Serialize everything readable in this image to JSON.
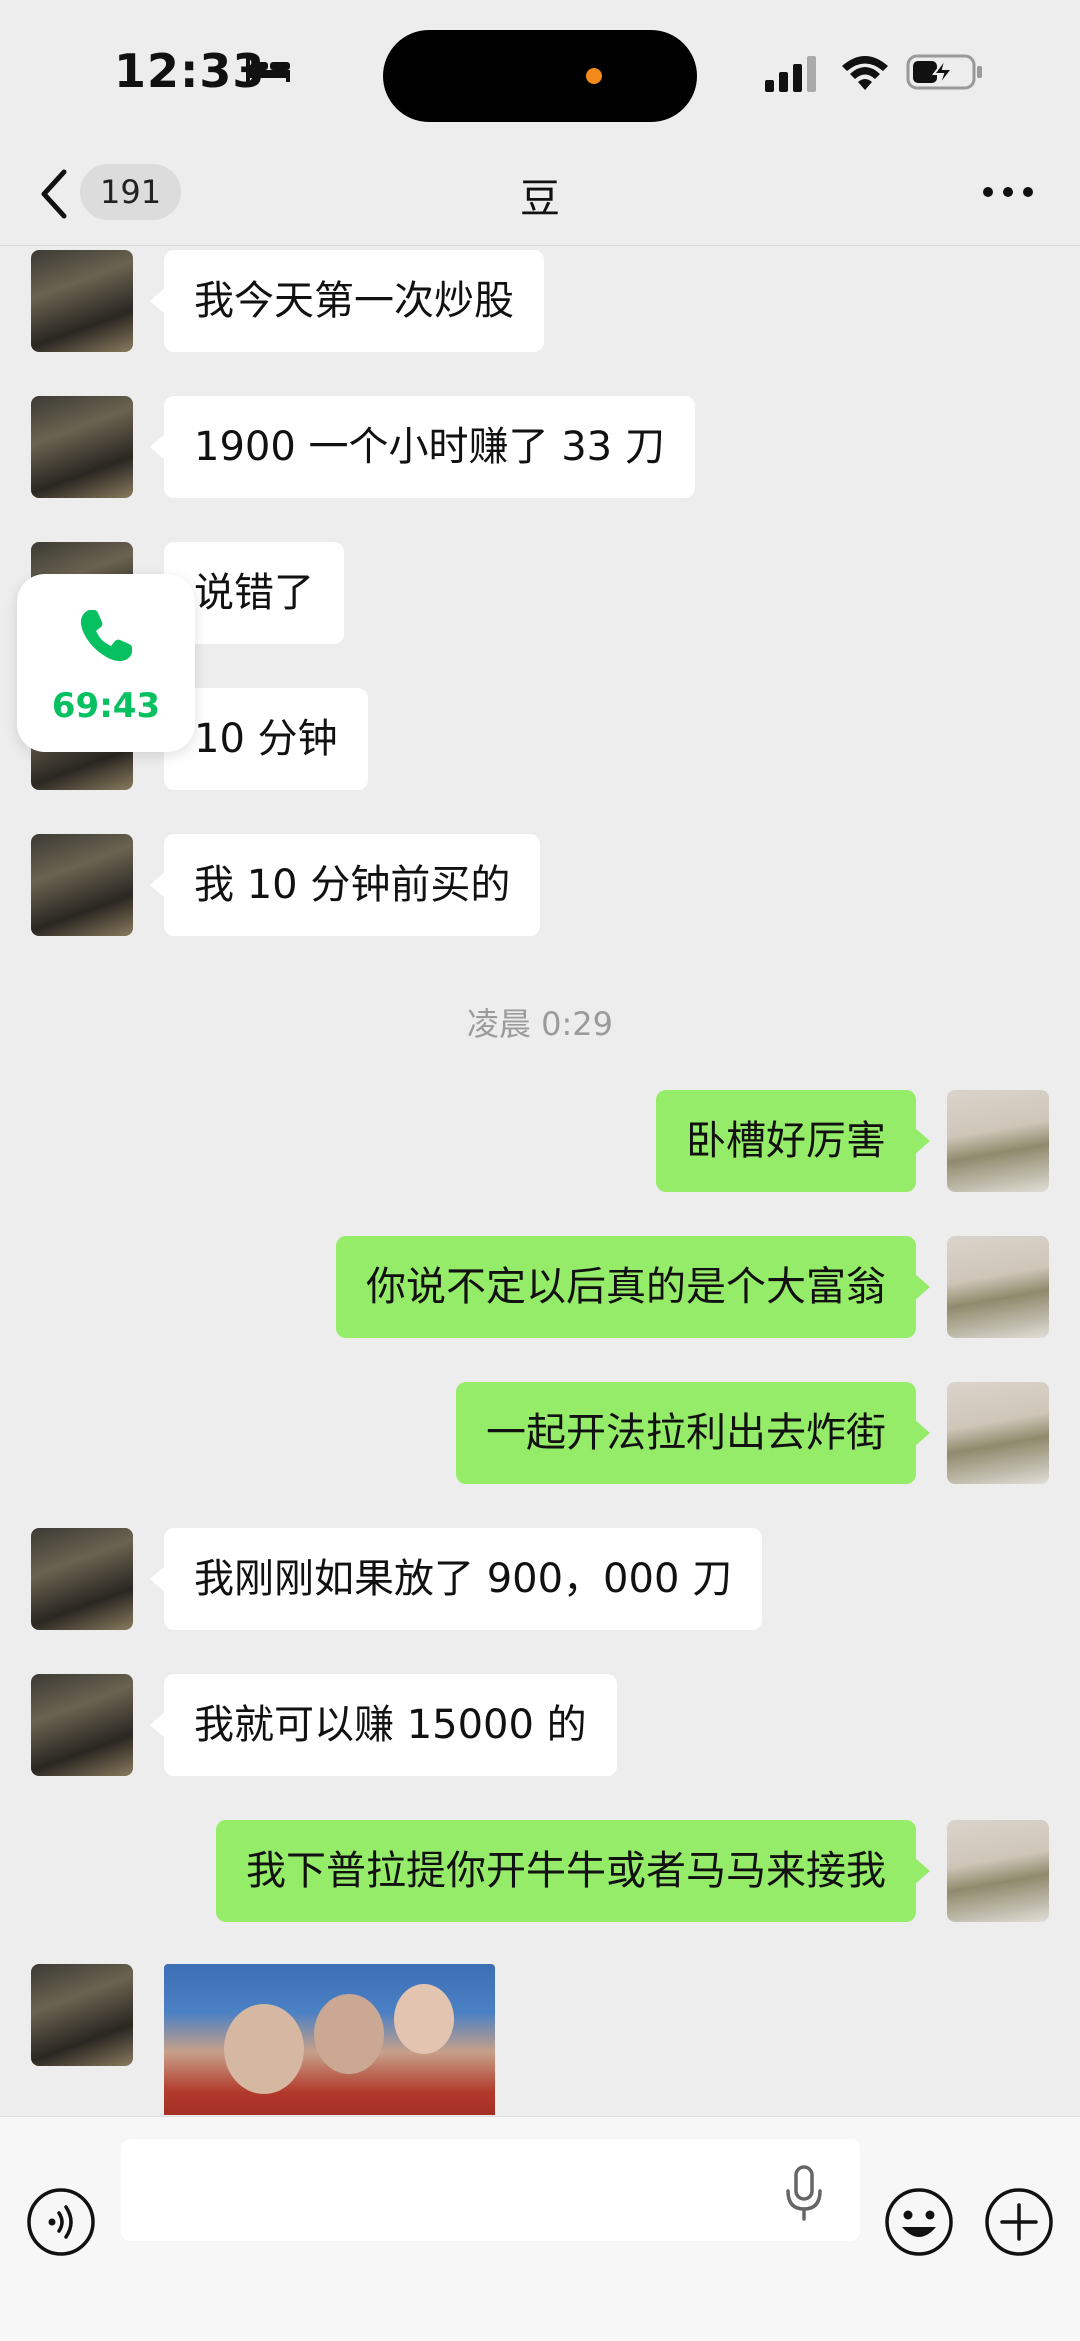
{
  "status_bar": {
    "time": "12:33",
    "icons": [
      "bed-icon",
      "signal-icon",
      "wifi-icon",
      "battery-charging-icon"
    ]
  },
  "nav": {
    "back_icon": "chevron-left-icon",
    "unread_count": "191",
    "title": "豆",
    "more_icon": "ellipsis-icon"
  },
  "messages": [
    {
      "sender": "other",
      "text": "我今天第一次炒股"
    },
    {
      "sender": "other",
      "text": "1900 一个小时赚了 33 刀"
    },
    {
      "sender": "other",
      "text": "说错了"
    },
    {
      "sender": "other",
      "text": "10 分钟"
    },
    {
      "sender": "other",
      "text": "我 10 分钟前买的"
    },
    {
      "sender": "me",
      "text": "卧槽好厉害"
    },
    {
      "sender": "me",
      "text": "你说不定以后真的是个大富翁"
    },
    {
      "sender": "me",
      "text": "一起开法拉利出去炸街"
    },
    {
      "sender": "other",
      "text": "我刚刚如果放了 900，000 刀"
    },
    {
      "sender": "other",
      "text": "我就可以赚 15000 的"
    },
    {
      "sender": "me",
      "text": "我下普拉提你开牛牛或者马马来接我"
    },
    {
      "sender": "other",
      "type": "image"
    }
  ],
  "timestamp": "凌晨 0:29",
  "call_widget": {
    "icon": "phone-icon",
    "duration": "69:43",
    "color": "#07c160"
  },
  "input_bar": {
    "voice_icon": "voice-toggle-icon",
    "mic_icon": "microphone-icon",
    "emoji_icon": "emoji-icon",
    "plus_icon": "plus-icon"
  },
  "colors": {
    "background": "#ededed",
    "outgoing_bubble": "#95ec69",
    "incoming_bubble": "#ffffff",
    "accent": "#07c160"
  }
}
